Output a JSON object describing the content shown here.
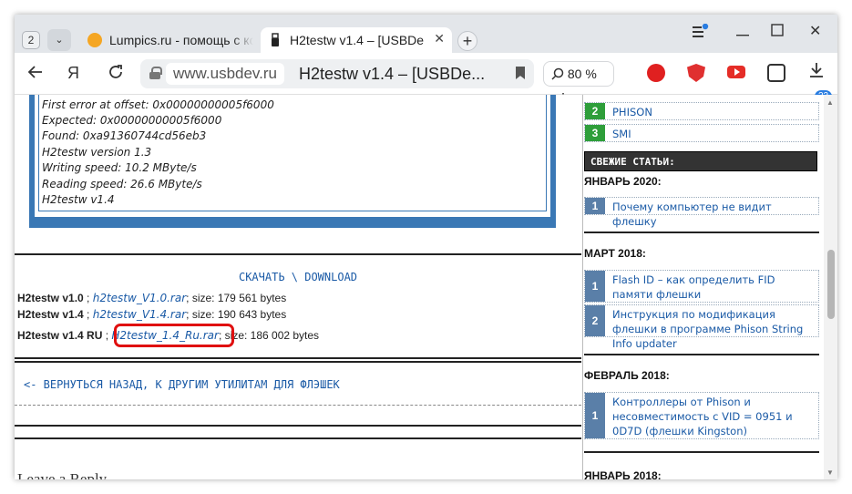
{
  "browser": {
    "tab_count": "2",
    "tabs": [
      {
        "title": "Lumpics.ru - помощь с ко",
        "active": false
      },
      {
        "title": "H2testw v1.4 – [USBDe",
        "active": true
      }
    ],
    "url_domain": "www.usbdev.ru",
    "page_title": "H2testw v1.4 – [USBDe...",
    "zoom": "80 %",
    "download_count": "22"
  },
  "code_lines": [
    "First error at offset: 0x00000000005f6000",
    "Expected: 0x00000000005f6000",
    "Found: 0xa91360744cd56eb3",
    "H2testw version 1.3",
    "Writing speed: 10.2 MByte/s",
    "Reading speed: 26.6 MByte/s",
    "H2testw v1.4"
  ],
  "download_link": "СКАЧАТЬ \\ DOWNLOAD",
  "files": [
    {
      "name": "H2testw v1.0",
      "sep": " ; ",
      "link": "h2testw_V1.0.rar",
      "size": "; size: 179 561 bytes"
    },
    {
      "name": "H2testw v1.4",
      "sep": " ; ",
      "link": "h2testw_V1.4.rar",
      "size": "; size: 190 643 bytes"
    },
    {
      "name": "H2testw v1.4 RU",
      "sep": " ; ",
      "link": "H2testw_1.4_Ru.rar",
      "size": "; size: 186 002 bytes"
    }
  ],
  "back_link": "<- ВЕРНУТЬСЯ НАЗАД, К ДРУГИМ УТИЛИТАМ ДЛЯ ФЛЭШЕК",
  "reply_heading": "Leave a Reply",
  "sidebar": {
    "top_items": [
      {
        "num": "2",
        "text": "PHISON"
      },
      {
        "num": "3",
        "text": "SMI"
      }
    ],
    "header": "СВЕЖИЕ СТАТЬИ:",
    "sections": [
      {
        "month": "ЯНВАРЬ 2020:",
        "items": [
          {
            "num": "1",
            "text": "Почему компьютер не видит флешку"
          }
        ]
      },
      {
        "month": "МАРТ 2018:",
        "items": [
          {
            "num": "1",
            "text": "Flash ID – как определить FID памяти флешки"
          },
          {
            "num": "2",
            "text": "Инструкция по модификация флешки в программе Phison String Info updater"
          }
        ]
      },
      {
        "month": "ФЕВРАЛЬ 2018:",
        "items": [
          {
            "num": "1",
            "text": "Контроллеры от Phison и несовместимость с VID = 0951 и 0D7D (флешки Kingston)"
          }
        ]
      },
      {
        "month": "ЯНВАРЬ 2018:",
        "items": []
      }
    ]
  }
}
